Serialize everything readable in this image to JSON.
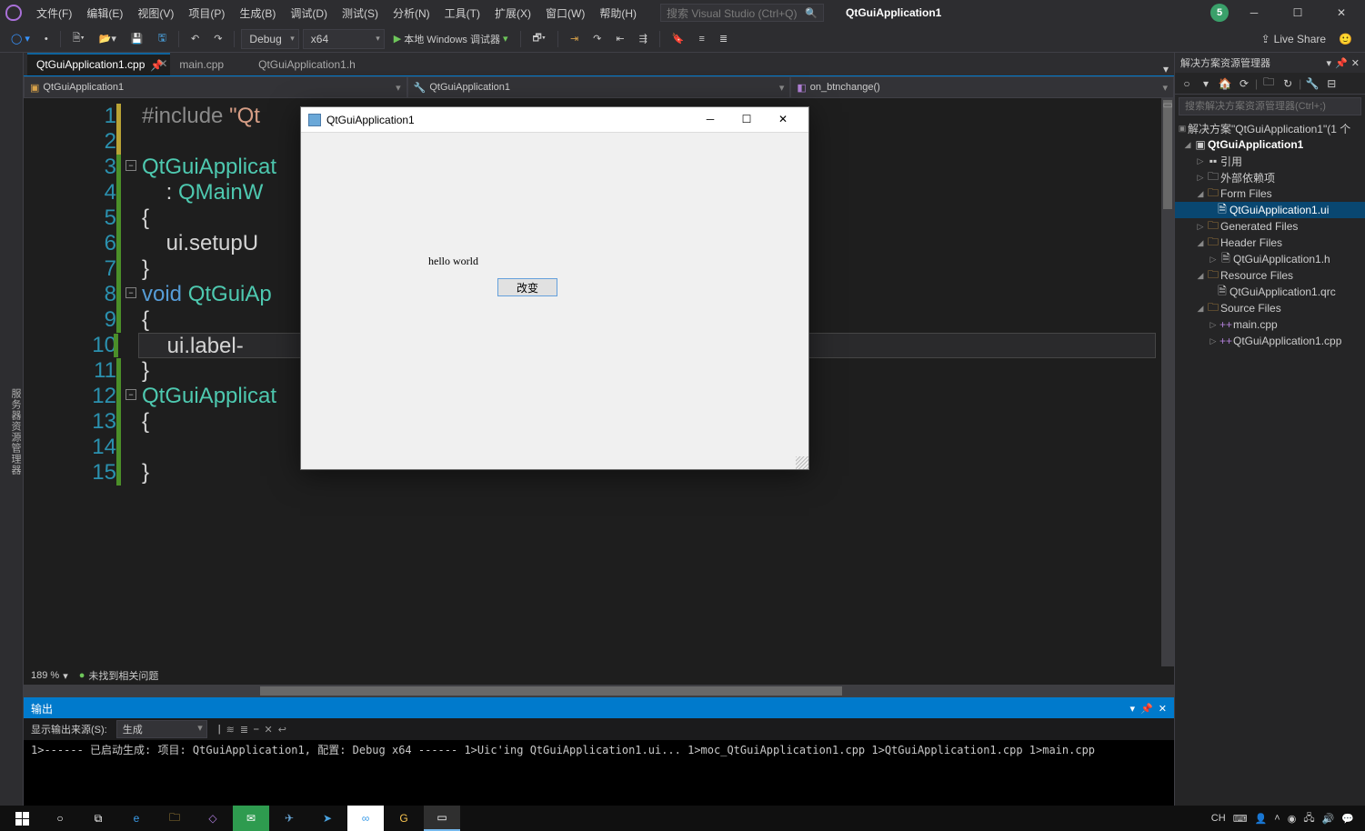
{
  "menubar": {
    "items": [
      "文件(F)",
      "编辑(E)",
      "视图(V)",
      "项目(P)",
      "生成(B)",
      "调试(D)",
      "测试(S)",
      "分析(N)",
      "工具(T)",
      "扩展(X)",
      "窗口(W)",
      "帮助(H)"
    ],
    "search_placeholder": "搜索 Visual Studio (Ctrl+Q)",
    "title": "QtGuiApplication1",
    "notif_count": "5"
  },
  "toolbar": {
    "config": "Debug",
    "platform": "x64",
    "run_label": "本地 Windows 调试器",
    "liveshare": "Live Share"
  },
  "tabs": [
    {
      "label": "QtGuiApplication1.cpp",
      "active": true
    },
    {
      "label": "main.cpp",
      "active": false
    },
    {
      "label": "QtGuiApplication1.h",
      "active": false
    }
  ],
  "navbar": {
    "scope": "QtGuiApplication1",
    "class": "QtGuiApplication1",
    "member": "on_btnchange()"
  },
  "code": {
    "lines": [
      {
        "n": "1",
        "html": "<span class='k-pre'>#include</span> <span class='k-inc'>\"Qt</span>"
      },
      {
        "n": "2",
        "html": ""
      },
      {
        "n": "3",
        "html": "<span class='k-type'>QtGuiApplicat</span>",
        "fold": true
      },
      {
        "n": "4",
        "html": "    : <span class='k-type'>QMainW</span>"
      },
      {
        "n": "5",
        "html": "{"
      },
      {
        "n": "6",
        "html": "    ui.setupU"
      },
      {
        "n": "7",
        "html": "}"
      },
      {
        "n": "8",
        "html": "<span class='k-kw'>void</span> <span class='k-type'>QtGuiAp</span>",
        "fold": true
      },
      {
        "n": "9",
        "html": "{"
      },
      {
        "n": "10",
        "html": "    ui.label-",
        "cursor": true
      },
      {
        "n": "11",
        "html": "}"
      },
      {
        "n": "12",
        "html": "<span class='k-type'>QtGuiApplicat</span>",
        "fold": true
      },
      {
        "n": "13",
        "html": "{"
      },
      {
        "n": "14",
        "html": ""
      },
      {
        "n": "15",
        "html": "}"
      }
    ]
  },
  "status": {
    "zoom": "189 %",
    "issues": "未找到相关问题"
  },
  "output": {
    "title": "输出",
    "from_label": "显示输出来源(S):",
    "from_value": "生成",
    "lines": [
      "1>------ 已启动生成: 项目: QtGuiApplication1, 配置: Debug x64 ------",
      "1>Uic'ing QtGuiApplication1.ui...",
      "1>moc_QtGuiApplication1.cpp",
      "1>QtGuiApplication1.cpp",
      "1>main.cpp"
    ]
  },
  "solution": {
    "title": "解决方案资源管理器",
    "search_placeholder": "搜索解决方案资源管理器(Ctrl+;)",
    "root": "解决方案\"QtGuiApplication1\"(1 个",
    "project": "QtGuiApplication1",
    "nodes": {
      "refs": "引用",
      "ext": "外部依赖项",
      "form": "Form Files",
      "form_item": "QtGuiApplication1.ui",
      "gen": "Generated Files",
      "hdr": "Header Files",
      "hdr_item": "QtGuiApplication1.h",
      "res": "Resource Files",
      "res_item": "QtGuiApplication1.qrc",
      "src": "Source Files",
      "src1": "main.cpp",
      "src2": "QtGuiApplication1.cpp"
    }
  },
  "appwin": {
    "title": "QtGuiApplication1",
    "label": "hello world",
    "button": "改变"
  },
  "tray": {
    "ime": "CH",
    "kb": "⌨"
  }
}
